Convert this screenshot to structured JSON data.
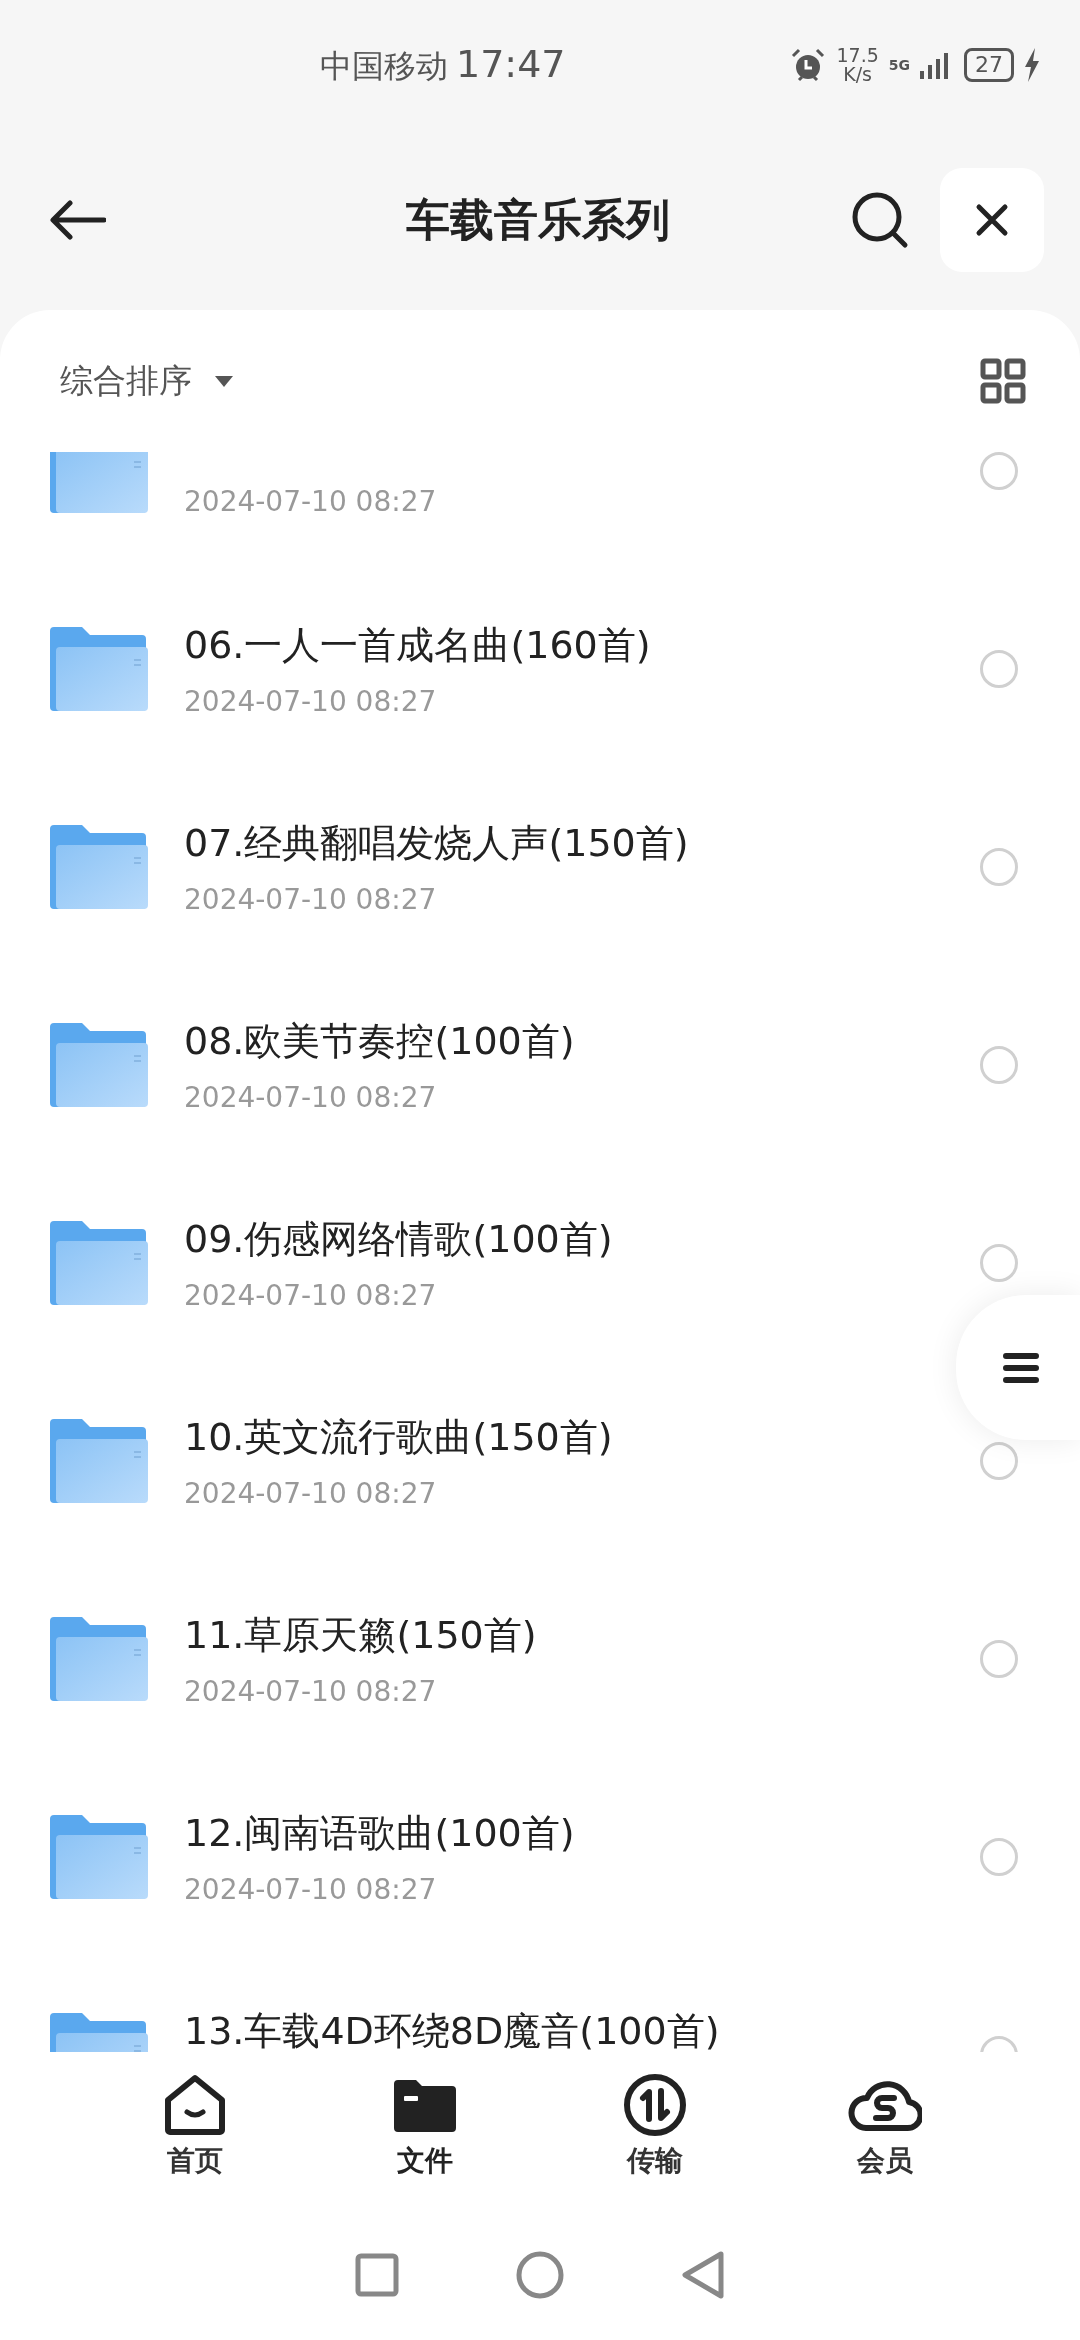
{
  "status_bar": {
    "carrier": "中国移动",
    "time": "17:47",
    "speed_value": "17.5",
    "speed_unit": "K/s",
    "network": "5G",
    "battery": "27"
  },
  "header": {
    "title": "车载音乐系列"
  },
  "sort": {
    "label": "综合排序"
  },
  "folders": [
    {
      "date": "2024-07-10 08:27",
      "selected": false
    },
    {
      "title": "06.一人一首成名曲(160首)",
      "date": "2024-07-10 08:27",
      "selected": false
    },
    {
      "title": "07.经典翻唱发烧人声(150首)",
      "date": "2024-07-10 08:27",
      "selected": false
    },
    {
      "title": "08.欧美节奏控(100首)",
      "date": "2024-07-10 08:27",
      "selected": false
    },
    {
      "title": "09.伤感网络情歌(100首)",
      "date": "2024-07-10 08:27",
      "selected": false
    },
    {
      "title": "10.英文流行歌曲(150首)",
      "date": "2024-07-10 08:27",
      "selected": false
    },
    {
      "title": "11.草原天籁(150首)",
      "date": "2024-07-10 08:27",
      "selected": false
    },
    {
      "title": "12.闽南语歌曲(100首)",
      "date": "2024-07-10 08:27",
      "selected": false
    },
    {
      "title": "13.车载4D环绕8D魔音(100首)",
      "selected": false
    }
  ],
  "tabs": [
    {
      "kind": "home",
      "label": "首页",
      "selected": false
    },
    {
      "kind": "files",
      "label": "文件",
      "selected": true
    },
    {
      "kind": "transfer",
      "label": "传输",
      "selected": false
    },
    {
      "kind": "member",
      "label": "会员",
      "selected": false
    }
  ]
}
